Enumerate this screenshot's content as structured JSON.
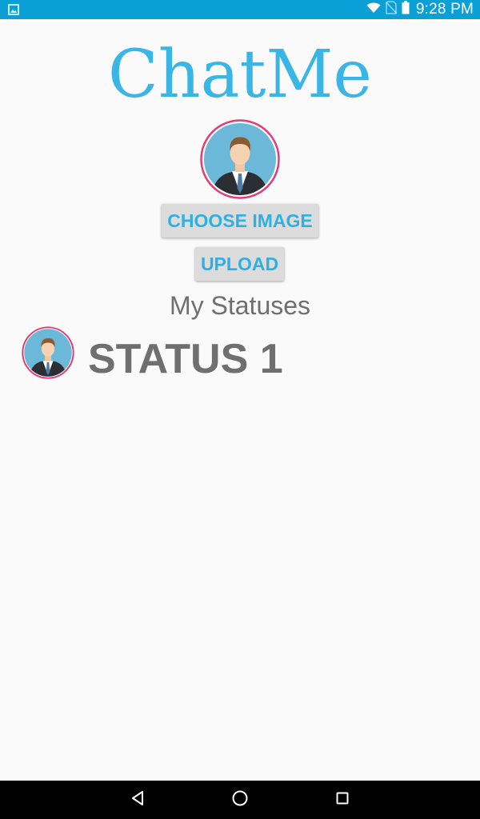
{
  "status_bar": {
    "time": "9:28 PM",
    "left_icon": "image-notification-icon",
    "right_icons": [
      "wifi-icon",
      "no-sim-icon",
      "battery-icon"
    ]
  },
  "app": {
    "title": "ChatMe",
    "accent_color": "#39b5e6",
    "status_bar_color": "#0aa0d6"
  },
  "profile": {
    "avatar_icon": "businessman-avatar-icon"
  },
  "buttons": {
    "choose_image": "CHOOSE IMAGE",
    "upload": "UPLOAD"
  },
  "statuses": {
    "heading": "My Statuses",
    "items": [
      {
        "label": "STATUS 1",
        "avatar_icon": "businessman-avatar-icon"
      }
    ]
  },
  "nav": {
    "back_icon": "back-triangle-icon",
    "home_icon": "home-circle-icon",
    "recents_icon": "recents-square-icon"
  }
}
